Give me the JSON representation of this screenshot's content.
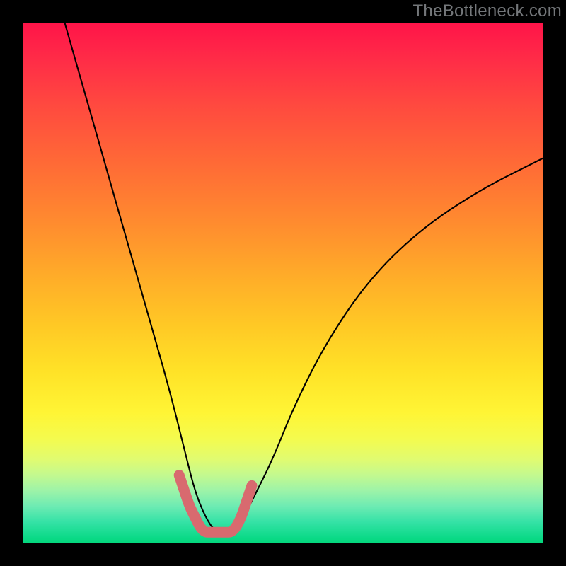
{
  "watermark": "TheBottleneck.com",
  "chart_data": {
    "type": "line",
    "title": "",
    "xlabel": "",
    "ylabel": "",
    "xlim": [
      0,
      100
    ],
    "ylim": [
      0,
      100
    ],
    "series": [
      {
        "name": "curve",
        "x": [
          8,
          12,
          16,
          20,
          24,
          28,
          31,
          33,
          35,
          37,
          40,
          42,
          44,
          48,
          52,
          58,
          66,
          76,
          88,
          100
        ],
        "y": [
          100,
          86,
          72,
          58,
          44,
          30,
          18,
          10,
          5,
          2,
          2,
          4,
          8,
          16,
          26,
          38,
          50,
          60,
          68,
          74
        ]
      }
    ],
    "highlight_region": {
      "description": "short coral segment near bottom of V",
      "x": [
        30,
        31,
        32,
        33,
        34,
        35,
        36,
        37,
        38,
        39,
        40,
        41,
        42,
        43,
        44
      ],
      "y": [
        13,
        10,
        7,
        5,
        3,
        2,
        2,
        2,
        2,
        2,
        2,
        3,
        5,
        8,
        11
      ]
    },
    "gradient_stops": [
      {
        "pos": 0.0,
        "color": "#ff1449"
      },
      {
        "pos": 0.38,
        "color": "#ff8a2f"
      },
      {
        "pos": 0.67,
        "color": "#ffe227"
      },
      {
        "pos": 0.84,
        "color": "#e0fb71"
      },
      {
        "pos": 1.0,
        "color": "#05d77d"
      }
    ]
  }
}
